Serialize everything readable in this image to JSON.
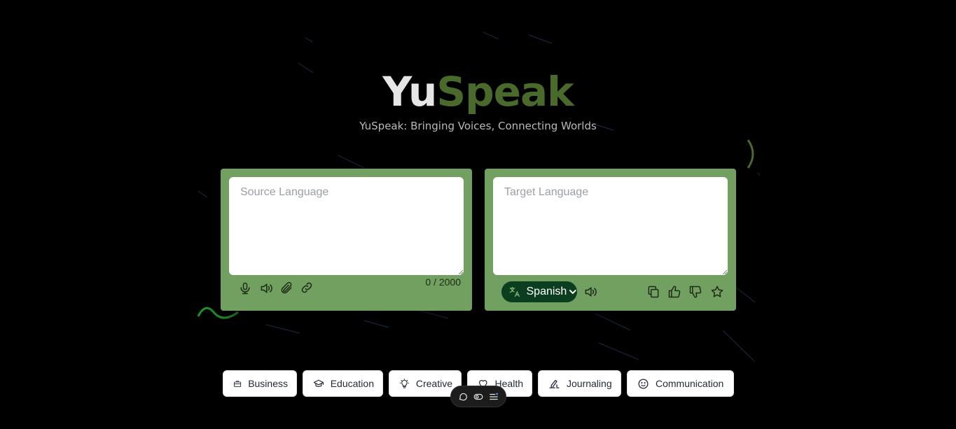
{
  "header": {
    "brand_part1": "Yu",
    "brand_part2": "Speak",
    "tagline": "YuSpeak: Bringing Voices, Connecting Worlds"
  },
  "source_panel": {
    "placeholder": "Source Language",
    "counter": "0 / 2000",
    "tools": [
      "microphone-icon",
      "speaker-icon",
      "paperclip-icon",
      "link-icon"
    ]
  },
  "target_panel": {
    "placeholder": "Target Language",
    "language_selected": "Spanish",
    "tools_left": [
      "speaker-icon"
    ],
    "tools_right": [
      "copy-icon",
      "thumbs-up-icon",
      "thumbs-down-icon",
      "star-icon"
    ]
  },
  "categories": [
    {
      "label": "Business",
      "icon": "briefcase-icon"
    },
    {
      "label": "Education",
      "icon": "graduation-cap-icon"
    },
    {
      "label": "Creative",
      "icon": "lightbulb-icon"
    },
    {
      "label": "Health",
      "icon": "heart-icon"
    },
    {
      "label": "Journaling",
      "icon": "pen-icon"
    },
    {
      "label": "Communication",
      "icon": "smile-icon"
    }
  ],
  "floating_toolbar": [
    "chat-bubble-icon",
    "toggle-icon",
    "menu-icon"
  ],
  "colors": {
    "background": "#000000",
    "panel": "#72a060",
    "brand_accent": "#4a6a2c",
    "language_pill": "#0b3d1f"
  }
}
